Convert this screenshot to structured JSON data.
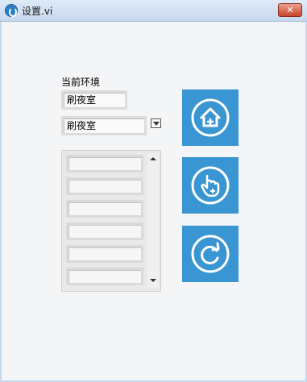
{
  "window": {
    "title": "设置.vi",
    "close_glyph": "✕"
  },
  "env": {
    "label": "当前环境",
    "current_value": "刷夜室",
    "select_value": "刷夜室"
  },
  "list": {
    "rows": [
      "",
      "",
      "",
      "",
      "",
      ""
    ]
  },
  "actions": {
    "icons": [
      "add-home-icon",
      "touch-add-icon",
      "refresh-icon"
    ],
    "tile_color": "#3a95d3"
  }
}
